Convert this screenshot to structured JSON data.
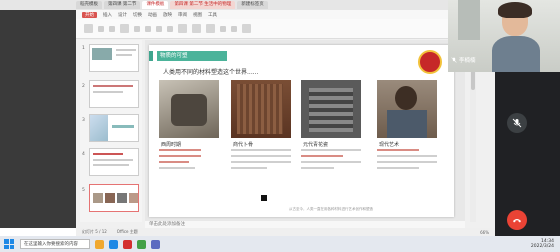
{
  "app": {
    "tabs": [
      {
        "label": "稻壳模板",
        "state": "normal"
      },
      {
        "label": "第四课 第二节",
        "state": "normal"
      },
      {
        "label": "课件模板",
        "state": "active"
      },
      {
        "label": "第四课 第二节 生活中的物理",
        "state": "red"
      },
      {
        "label": "新建标签页",
        "state": "normal"
      }
    ],
    "ribbon_tabs": [
      "开始",
      "插入",
      "设计",
      "切换",
      "动画",
      "放映",
      "审阅",
      "视图",
      "工具"
    ],
    "ribbon_active": "开始"
  },
  "slides": {
    "numbers": [
      "1",
      "2",
      "3",
      "4",
      "5"
    ],
    "selected": 5
  },
  "slide": {
    "title": "物质的可塑",
    "subtitle": "人类用不同的材料塑造这个世界......",
    "captions": [
      "西周时期",
      "商代卜骨",
      "元代青花瓷",
      "现代艺术"
    ],
    "footer": "从古至今，人类一直在用各种材料进行艺术创作和塑造"
  },
  "notes": {
    "placeholder": "单击此处添加备注"
  },
  "statusbar": {
    "slide_info": "幻灯片 5 / 12",
    "theme": "Office 主题",
    "zoom": "66%"
  },
  "meeting": {
    "participant_name": "李楠楠"
  },
  "taskbar": {
    "search_placeholder": "在这里输入你要搜索的内容",
    "time": "14:34",
    "date": "2022/3/24"
  }
}
